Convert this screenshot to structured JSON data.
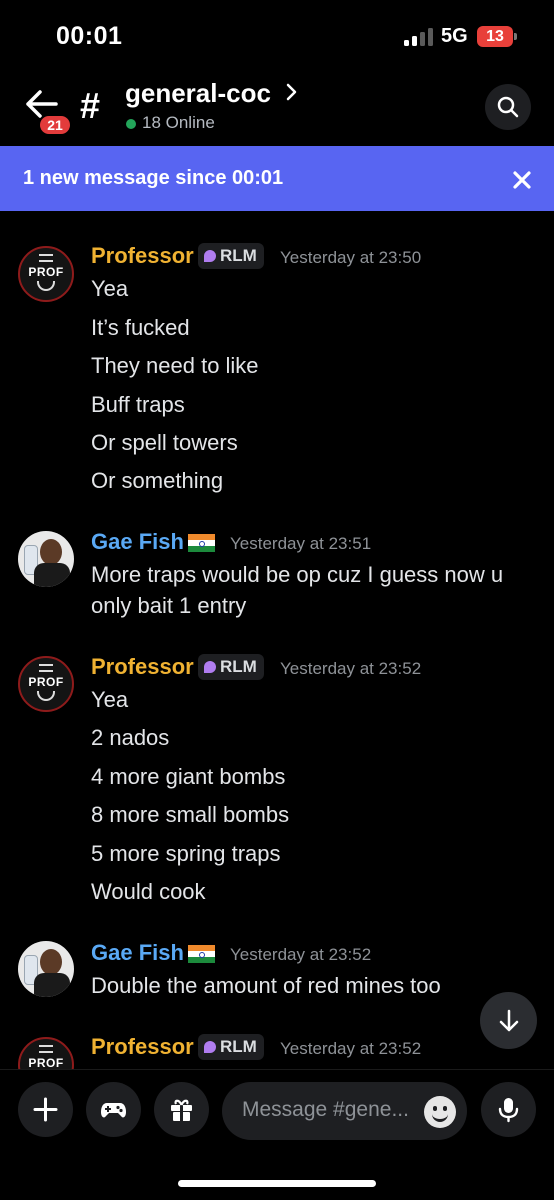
{
  "status_bar": {
    "time": "00:01",
    "network": "5G",
    "battery": "13"
  },
  "header": {
    "back_badge": "21",
    "channel_name": "general-coc",
    "online": "18 Online"
  },
  "banner": {
    "text": "1 new message since 00:01"
  },
  "messages": [
    {
      "author": "Professor",
      "tag": "RLM",
      "time": "Yesterday at 23:50",
      "lines": [
        "Yea",
        "It’s fucked",
        "They need to like",
        "Buff traps",
        "Or spell towers",
        "Or something"
      ]
    },
    {
      "author": "Gae Fish",
      "flag": "india-flag",
      "time": "Yesterday at 23:51",
      "lines": [
        "More traps would be op cuz I guess now u",
        "only bait 1 entry"
      ]
    },
    {
      "author": "Professor",
      "tag": "RLM",
      "time": "Yesterday at 23:52",
      "lines": [
        "Yea",
        "2 nados",
        "4 more giant bombs",
        "8 more small bombs",
        "5 more spring traps",
        "Would cook"
      ]
    },
    {
      "author": "Gae Fish",
      "flag": "india-flag",
      "time": "Yesterday at 23:52",
      "lines": [
        "Double the amount of red mines too"
      ]
    },
    {
      "author": "Professor",
      "tag": "RLM",
      "time": "Yesterday at 23:52",
      "lines": []
    }
  ],
  "avatar_labels": {
    "professor": "PROF"
  },
  "composer": {
    "placeholder": "Message #gene..."
  },
  "colors": {
    "accent": "#5865f2",
    "professor_name": "#f0b232",
    "gaefish_name": "#5aa9f5",
    "online": "#23a55a",
    "badge": "#e23b3b",
    "tag_icon": "#b07df0"
  },
  "icons": [
    "back-arrow-icon",
    "hash-icon",
    "chevron-right-icon",
    "search-icon",
    "close-icon",
    "arrow-down-icon",
    "plus-icon",
    "gamepad-icon",
    "gift-icon",
    "emoji-icon",
    "microphone-icon"
  ]
}
